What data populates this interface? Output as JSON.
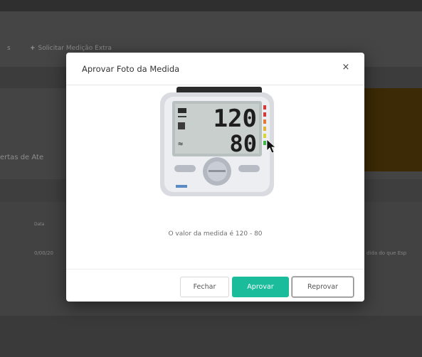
{
  "background": {
    "toolbar_left": "s",
    "toolbar_add_label": "Solicitar Medição Extra",
    "section_title": "ertas de Ate",
    "table_header": "Data",
    "row_date": "0/00/20",
    "row_tail": "dida do que Esp"
  },
  "modal": {
    "title": "Aprovar Foto da Medida",
    "close_symbol": "×",
    "device_readings": {
      "systolic": "120",
      "diastolic": "80"
    },
    "measure_text": "O valor da medida é 120 - 80",
    "buttons": {
      "close": "Fechar",
      "approve": "Aprovar",
      "reject": "Reprovar"
    }
  },
  "colors": {
    "approve": "#1abc9c",
    "backdrop": "#4a4a4a",
    "alert_band": "#3b2a05"
  },
  "icons": {
    "add": "plus-icon",
    "close": "close-icon",
    "cursor": "mouse-pointer-icon"
  }
}
